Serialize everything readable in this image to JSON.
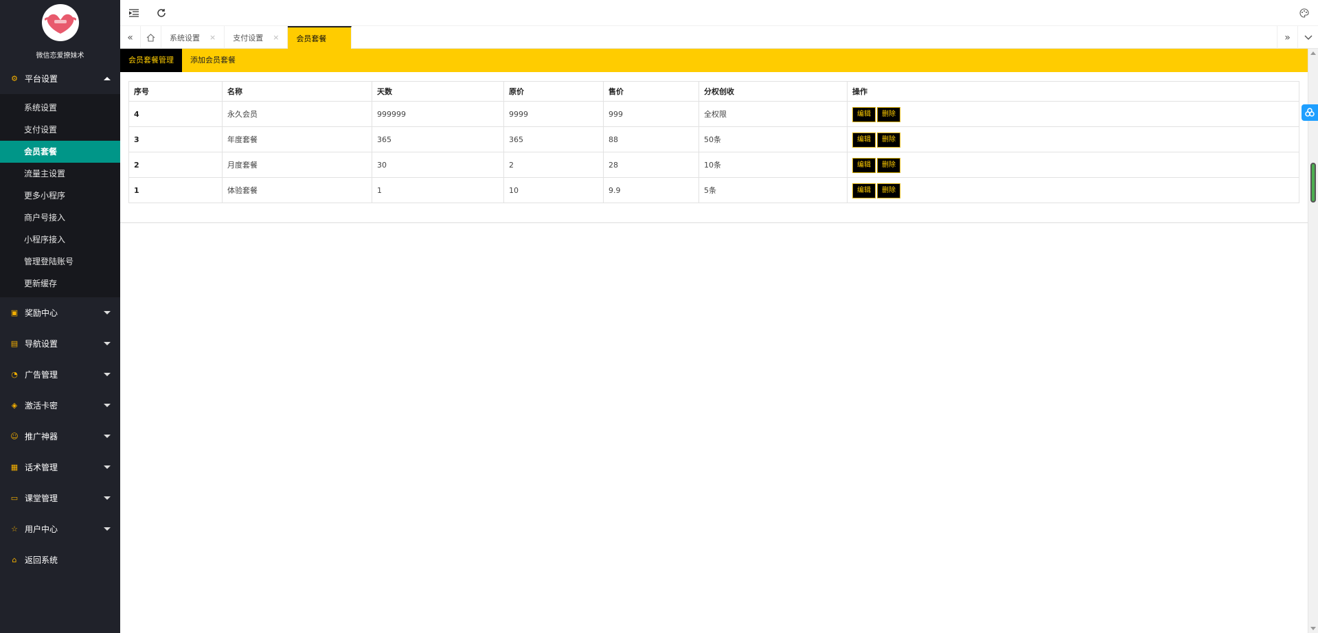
{
  "brand": {
    "text": "微信恋爱撩妹术"
  },
  "header": {
    "collapse_icon": "indent-icon",
    "refresh_icon": "refresh-icon",
    "theme_icon": "palette-icon"
  },
  "sidebar": {
    "groups": [
      {
        "label": "平台设置",
        "icon": "gear-icon",
        "expanded": true,
        "items": [
          {
            "label": "系统设置"
          },
          {
            "label": "支付设置"
          },
          {
            "label": "会员套餐",
            "active": true
          },
          {
            "label": "流量主设置"
          },
          {
            "label": "更多小程序"
          },
          {
            "label": "商户号接入"
          },
          {
            "label": "小程序接入"
          },
          {
            "label": "管理登陆账号"
          },
          {
            "label": "更新缓存"
          }
        ]
      },
      {
        "label": "奖励中心",
        "icon": "reward-icon"
      },
      {
        "label": "导航设置",
        "icon": "nav-icon"
      },
      {
        "label": "广告管理",
        "icon": "dashboard-icon"
      },
      {
        "label": "激活卡密",
        "icon": "box-icon"
      },
      {
        "label": "推广神器",
        "icon": "smile-icon"
      },
      {
        "label": "话术管理",
        "icon": "doc-icon"
      },
      {
        "label": "课堂管理",
        "icon": "bus-icon"
      },
      {
        "label": "用户中心",
        "icon": "star-icon"
      },
      {
        "label": "返回系统",
        "icon": "home-icon"
      }
    ]
  },
  "tabs": {
    "items": [
      {
        "label": "系统设置"
      },
      {
        "label": "支付设置"
      },
      {
        "label": "会员套餐",
        "active": true
      }
    ],
    "close_glyph": "×"
  },
  "subtabs": [
    {
      "label": "会员套餐管理",
      "active": true
    },
    {
      "label": "添加会员套餐"
    }
  ],
  "table": {
    "headers": [
      "序号",
      "名称",
      "天数",
      "原价",
      "售价",
      "分权创收",
      "操作"
    ],
    "rows": [
      [
        "4",
        "永久会员",
        "999999",
        "9999",
        "999",
        "全权限"
      ],
      [
        "3",
        "年度套餐",
        "365",
        "365",
        "88",
        "50条"
      ],
      [
        "2",
        "月度套餐",
        "30",
        "2",
        "28",
        "10条"
      ],
      [
        "1",
        "体验套餐",
        "1",
        "10",
        "9.9",
        "5条"
      ]
    ],
    "edit_label": "编辑",
    "delete_label": "删除"
  },
  "colors": {
    "accent": "#ffcc00",
    "sidebar_bg": "#20222a",
    "active_item": "#009688"
  }
}
